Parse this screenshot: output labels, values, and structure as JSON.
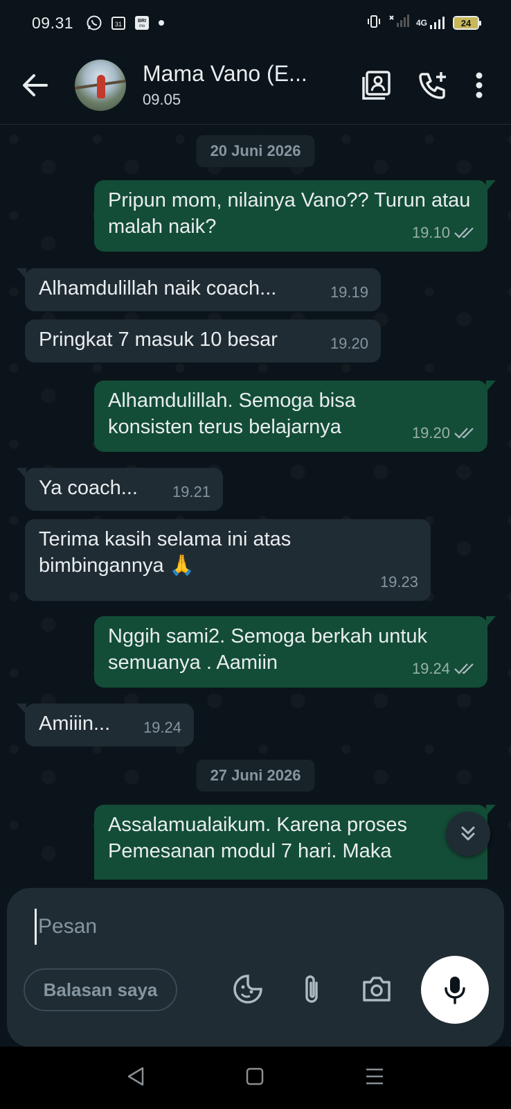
{
  "status_bar": {
    "time": "09.31",
    "battery": "24",
    "network": "4G",
    "icons": [
      "whatsapp-icon",
      "calendar-icon",
      "brimo-icon",
      "dot-icon",
      "vibrate-icon",
      "signal-icon",
      "battery-icon"
    ],
    "calendar_day": "31",
    "brimo_label": "BRI mo"
  },
  "header": {
    "contact_name": "Mama Vano (E...",
    "last_seen": "09.05"
  },
  "chat": {
    "date_1": "20 Juni 2026",
    "date_2": "27 Juni 2026",
    "messages": [
      {
        "dir": "out",
        "text": "Pripun mom, nilainya Vano?? Turun atau malah naik?",
        "time": "19.10"
      },
      {
        "dir": "in",
        "text": "Alhamdulillah naik coach...",
        "time": "19.19"
      },
      {
        "dir": "in",
        "text": "Pringkat 7 masuk 10 besar",
        "time": "19.20"
      },
      {
        "dir": "out",
        "text": "Alhamdulillah. Semoga bisa konsisten terus belajarnya",
        "time": "19.20"
      },
      {
        "dir": "in",
        "text": "Ya coach...",
        "time": "19.21"
      },
      {
        "dir": "in",
        "text": "Terima kasih selama ini atas bimbingannya 🙏",
        "time": "19.23"
      },
      {
        "dir": "out",
        "text": "Nggih sami2. Semoga berkah untuk semuanya . Aamiin",
        "time": "19.24"
      },
      {
        "dir": "in",
        "text": "Amiiin...",
        "time": "19.24"
      },
      {
        "dir": "out",
        "text": "Assalamualaikum. Karena proses Pemesanan modul 7 hari. Maka",
        "time": ""
      }
    ]
  },
  "composer": {
    "placeholder": "Pesan",
    "reply_chip": "Balasan saya"
  },
  "colors": {
    "background": "#0b141a",
    "outgoing_bubble": "#134d37",
    "incoming_bubble": "#202c33",
    "date_chip": "#182229",
    "composer": "#1f2c34"
  }
}
